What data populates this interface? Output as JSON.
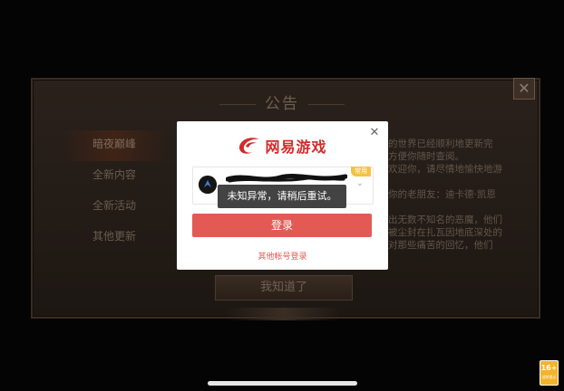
{
  "notice": {
    "title": "公告",
    "close": "✕",
    "menu": [
      "暗夜巅峰",
      "全新内容",
      "全新活动",
      "其他更新"
    ],
    "text_lines": [
      "的世界已经顺利地更新完",
      "方便你随时查阅。",
      "欢迎你，请尽情地愉快地游",
      "",
      "你的老朋友：迪卡德·凯恩",
      "",
      "出无数不知名的恶魔，他们",
      "被尘封在扎瓦因地底深处的",
      "对那些痛苦的回忆，他们"
    ],
    "confirm": "我知道了"
  },
  "login": {
    "brand": "网易游戏",
    "close": "✕",
    "account_tag": "常用",
    "chevron": "⌄",
    "login_button": "登录",
    "other_login": "其他帐号登录"
  },
  "toast": {
    "message": "未知异常，请稍后重试。"
  },
  "age_badge": {
    "number": "16+",
    "label": "适龄提示"
  },
  "colors": {
    "brand_red": "#d22a2a",
    "login_button": "#e35a55",
    "toast_bg": "#333333"
  }
}
